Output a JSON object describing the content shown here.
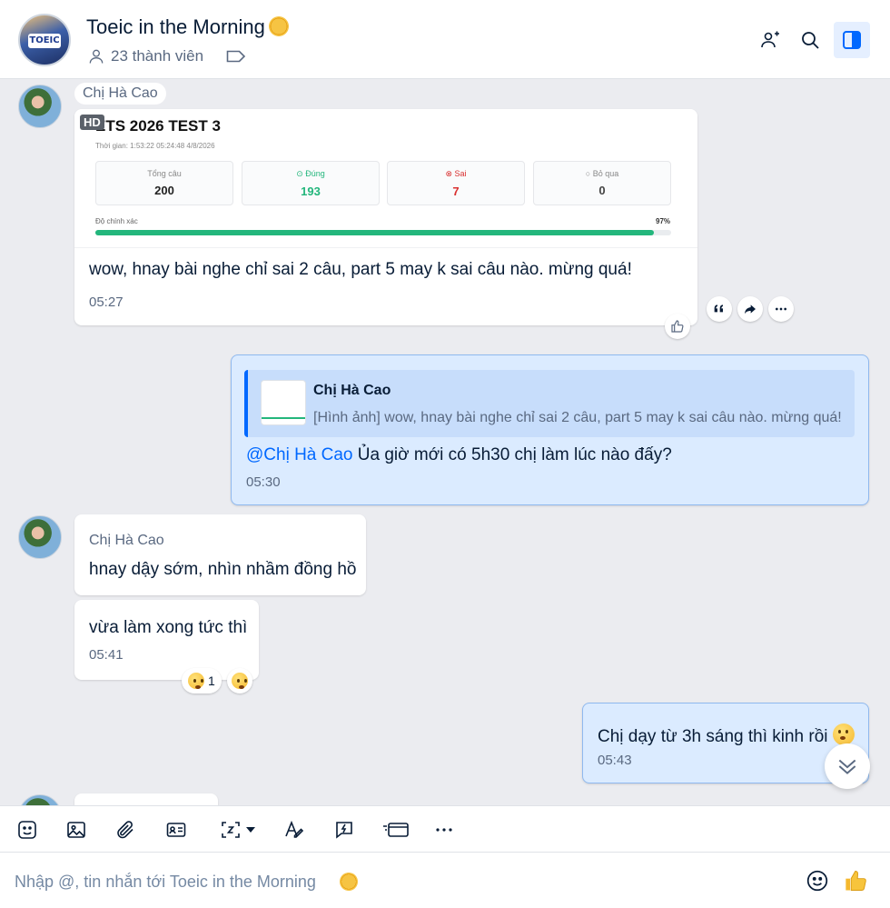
{
  "header": {
    "title": "Toeic in the Morning",
    "avatar_text": "TOEIC",
    "members_label": "23 thành viên",
    "icons": [
      "add-member-icon",
      "search-icon",
      "sidebar-toggle-icon"
    ]
  },
  "messages": {
    "m1": {
      "sender": "Chị Hà Cao",
      "image": {
        "hd_badge": "HD",
        "title": "ETS 2026 TEST 3",
        "meta": "Thời gian: 1:53:22   05:24:48 4/8/2026",
        "stats": [
          {
            "label": "Tổng câu",
            "value": "200"
          },
          {
            "label": "Đúng",
            "value": "193"
          },
          {
            "label": "Sai",
            "value": "7"
          },
          {
            "label": "Bỏ qua",
            "value": "0"
          }
        ],
        "accuracy_label": "Độ chính xác",
        "accuracy_value": "97%",
        "accuracy_fraction": 0.97
      },
      "text": "wow, hnay bài nghe chỉ sai 2 câu, part 5 may k sai câu nào. mừng quá!",
      "time": "05:27"
    },
    "m2": {
      "quote_sender": "Chị Hà Cao",
      "quote_text": "[Hình ảnh] wow, hnay bài nghe chỉ sai 2 câu, part 5 may k sai câu nào. mừng quá!",
      "mention": "@Chị Hà Cao",
      "text": " Ủa giờ mới có 5h30 chị làm lúc nào đấy?",
      "time": "05:30"
    },
    "m3": {
      "sender": "Chị Hà Cao",
      "text": "hnay dậy sớm, nhìn nhầm đồng hồ"
    },
    "m4": {
      "text": "vừa làm xong tức thì",
      "time": "05:41",
      "reaction_count": "1"
    },
    "m5": {
      "text": "Chị dạy từ 3h sáng thì kinh rồi",
      "time": "05:43"
    }
  },
  "composer": {
    "placeholder": "Nhập @, tin nhắn tới Toeic in the Morning"
  },
  "colors": {
    "accent": "#0068ff",
    "my_bubble": "#dbebff",
    "success": "#23b67c",
    "error": "#d93030"
  }
}
